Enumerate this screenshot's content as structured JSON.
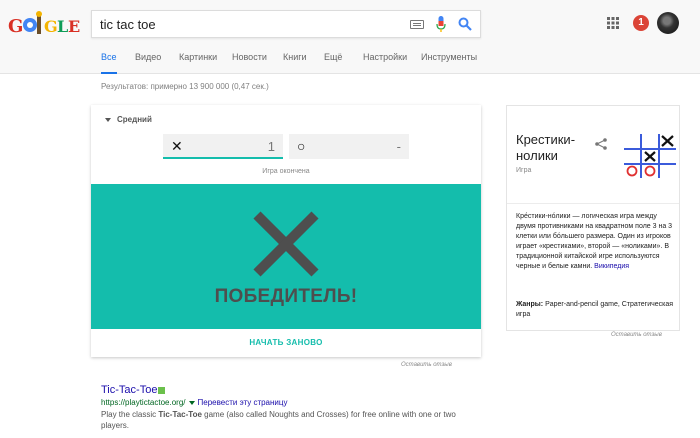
{
  "header": {
    "logo_text": "GOOGLE",
    "search_value": "tic tac toe",
    "keyboard_icon": "keyboard-icon",
    "mic_icon": "mic-icon",
    "search_icon": "search-icon",
    "apps_icon": "apps-grid-icon",
    "notification_count": "1"
  },
  "tabs": [
    {
      "label": "Все",
      "active": true
    },
    {
      "label": "Видео"
    },
    {
      "label": "Картинки"
    },
    {
      "label": "Новости"
    },
    {
      "label": "Книги"
    },
    {
      "label": "Ещё"
    },
    {
      "label": "Настройки"
    },
    {
      "label": "Инструменты"
    }
  ],
  "results_count": "Результатов: примерно 13 900 000 (0,47 сек.)",
  "game": {
    "difficulty": "Средний",
    "player_x_symbol": "✕",
    "player_x_score": "1",
    "player_o_symbol": "○",
    "player_o_score": "-",
    "status": "Игра окончена",
    "winner_text": "ПОБЕДИТЕЛЬ!",
    "restart_label": "НАЧАТЬ ЗАНОВО",
    "feedback": "Оставить отзыв",
    "colors": {
      "board": "#14bdac",
      "mark": "#4e4e4e"
    }
  },
  "result": {
    "title": "Tic-Tac-Toe",
    "url": "https://playtictactoe.org/",
    "translate": "Перевести эту страницу",
    "snippet_before": "Play the classic ",
    "snippet_bold": "Tic-Tac-Toe",
    "snippet_after": " game (also called Noughts and Crosses) for free online with one or two players."
  },
  "knowledge_panel": {
    "title": "Крестики-нолики",
    "subtitle": "Игра",
    "share_icon": "share-icon",
    "description": "Кре́стики-но́лики — логическая игра между двумя противниками на квадратном поле 3 на 3 клетки или бо́льшего размера. Один из игроков играет «крестиками», второй — «ноликами». В традиционной китайской игре используются черные и белые камни.",
    "wiki_link": "Википедия",
    "genres_label": "Жанры:",
    "genres_value": "Paper-and-pencil game, Стратегическая игра",
    "feedback": "Оставить отзыв"
  }
}
